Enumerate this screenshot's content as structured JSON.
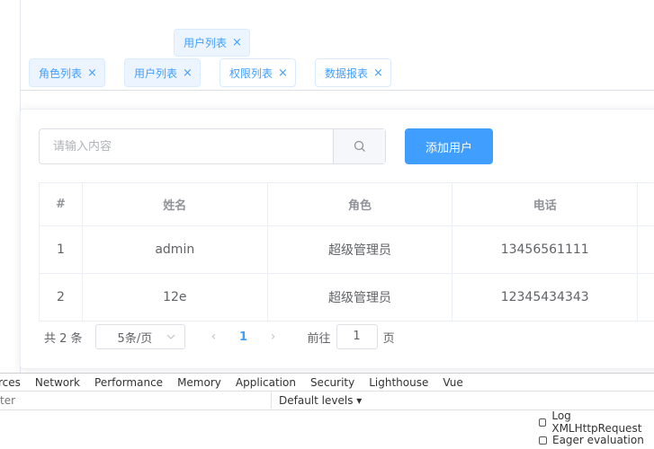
{
  "floating_tag": {
    "label": "用户列表"
  },
  "tabs": [
    {
      "label": "角色列表"
    },
    {
      "label": "用户列表"
    },
    {
      "label": "权限列表"
    },
    {
      "label": "数据报表"
    }
  ],
  "search": {
    "placeholder": "请输入内容",
    "value": ""
  },
  "add_button": {
    "label": "添加用户"
  },
  "table": {
    "headers": [
      "#",
      "姓名",
      "角色",
      "电话"
    ],
    "rows": [
      {
        "index": "1",
        "name": "admin",
        "role": "超级管理员",
        "phone": "13456561111"
      },
      {
        "index": "2",
        "name": "12e",
        "role": "超级管理员",
        "phone": "12345434343"
      }
    ]
  },
  "pagination": {
    "total_text": "共 2 条",
    "page_size": "5条/页",
    "prev": "‹",
    "current_page": "1",
    "next": "›",
    "goto_label": "前往",
    "goto_value": "1",
    "goto_suffix": "页"
  },
  "devtools": {
    "tabs": [
      "rces",
      "Network",
      "Performance",
      "Memory",
      "Application",
      "Security",
      "Lighthouse",
      "Vue"
    ],
    "filter_text": "ter",
    "levels": "Default levels ▾",
    "options": [
      "Log XMLHttpRequest",
      "Eager evaluation"
    ]
  },
  "colors": {
    "primary": "#409eff",
    "tag_bg": "#ecf5ff",
    "border": "#dcdfe6"
  }
}
